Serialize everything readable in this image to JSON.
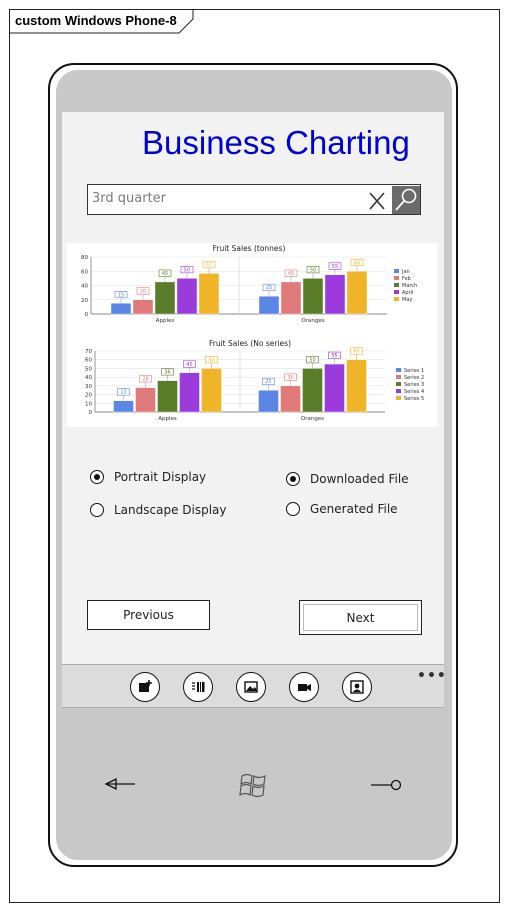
{
  "frame": {
    "title": "custom Windows Phone-8"
  },
  "app": {
    "title": "Business Charting"
  },
  "search": {
    "value": "3rd quarter",
    "clear_icon": "close-icon",
    "search_icon": "search-icon"
  },
  "chart_data": [
    {
      "type": "bar",
      "title": "Fruit Sales (tonnes)",
      "categories": [
        "Apples",
        "Oranges"
      ],
      "ylim": [
        0,
        80
      ],
      "yticks": [
        0,
        20,
        40,
        60,
        80
      ],
      "legend": "right",
      "grid": true,
      "series": [
        {
          "name": "Jan",
          "color": "#5b86e5",
          "values": [
            15,
            25
          ]
        },
        {
          "name": "Feb",
          "color": "#e07a7a",
          "values": [
            20,
            45
          ]
        },
        {
          "name": "March",
          "color": "#5a7d2a",
          "values": [
            45,
            50
          ]
        },
        {
          "name": "April",
          "color": "#9b3bdc",
          "values": [
            50,
            55
          ]
        },
        {
          "name": "May",
          "color": "#f0b429",
          "values": [
            57,
            60
          ]
        }
      ]
    },
    {
      "type": "bar",
      "title": "Fruit Sales (No series)",
      "categories": [
        "Apples",
        "Oranges"
      ],
      "ylim": [
        0,
        70
      ],
      "yticks": [
        0,
        10,
        20,
        30,
        40,
        50,
        60,
        70
      ],
      "legend": "right",
      "grid": true,
      "series": [
        {
          "name": "Series 1",
          "color": "#5b86e5",
          "values": [
            13,
            25
          ]
        },
        {
          "name": "Series 2",
          "color": "#e07a7a",
          "values": [
            28,
            30
          ]
        },
        {
          "name": "Series 3",
          "color": "#5a7d2a",
          "values": [
            36,
            50
          ]
        },
        {
          "name": "Series 4",
          "color": "#9b3bdc",
          "values": [
            45,
            55
          ]
        },
        {
          "name": "Series 5",
          "color": "#f0b429",
          "values": [
            50,
            60
          ]
        }
      ]
    }
  ],
  "options": {
    "display": [
      {
        "label": "Portrait Display",
        "selected": true
      },
      {
        "label": "Landscape Display",
        "selected": false
      }
    ],
    "source": [
      {
        "label": "Downloaded File",
        "selected": true
      },
      {
        "label": "Generated File",
        "selected": false
      }
    ]
  },
  "nav": {
    "previous": "Previous",
    "next": "Next"
  },
  "appbar": {
    "buttons": [
      "add-icon",
      "barcode-icon",
      "picture-icon",
      "video-icon",
      "contact-icon"
    ],
    "more": "•••"
  },
  "hardware": {
    "back": "back-icon",
    "start": "windows-logo-icon",
    "search": "search-icon"
  }
}
